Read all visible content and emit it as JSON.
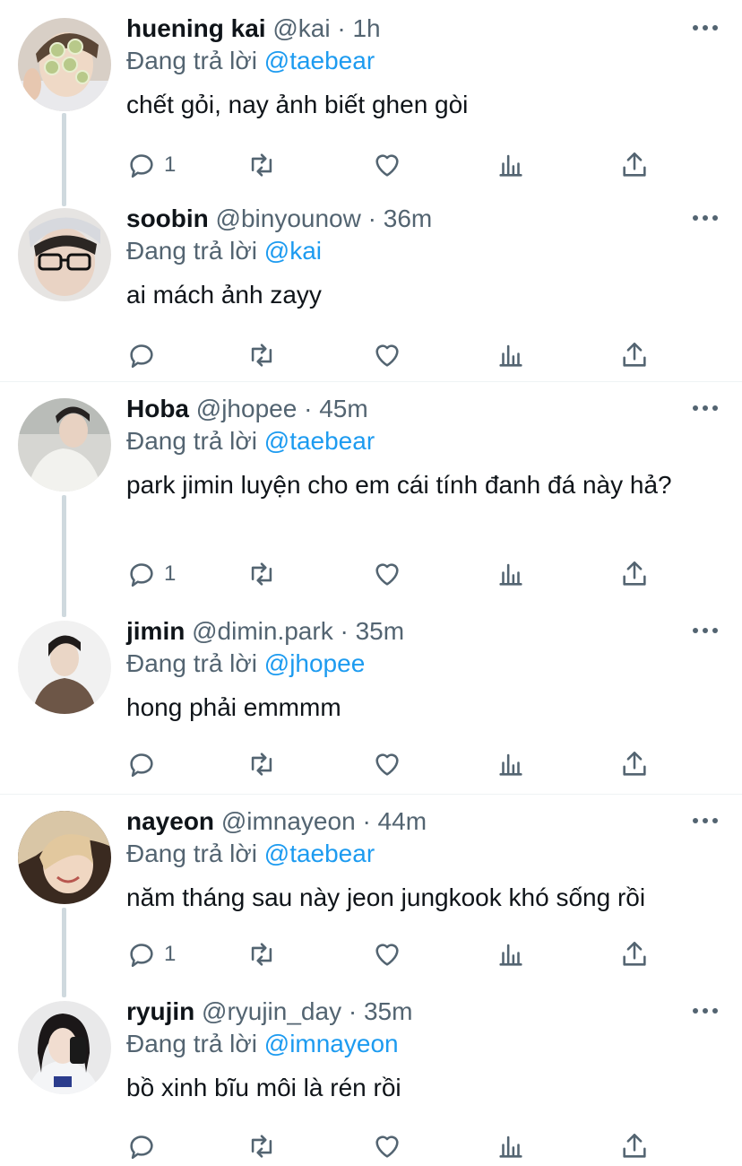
{
  "reply_prefix": "Đang trả lời",
  "colors": {
    "link": "#1d9bf0",
    "muted": "#536471",
    "text": "#0f1419",
    "thread_line": "#cfd9de"
  },
  "icons": [
    "reply-icon",
    "retweet-icon",
    "like-icon",
    "analytics-icon",
    "share-icon",
    "more-icon"
  ],
  "tweets": [
    {
      "name": "huening kai",
      "handle": "@kai",
      "sep": "·",
      "time": "1h",
      "reply_to": "@taebear",
      "text": "chết gỏi, nay ảnh biết ghen gòi",
      "reply_count": "1"
    },
    {
      "name": "soobin",
      "handle": "@binyounow",
      "sep": "·",
      "time": "36m",
      "reply_to": "@kai",
      "text": "ai mách ảnh zayy",
      "reply_count": ""
    },
    {
      "name": "Hoba",
      "handle": "@jhopee",
      "sep": "·",
      "time": "45m",
      "reply_to": "@taebear",
      "text": "park jimin luyện cho em cái tính đanh đá này hả?",
      "reply_count": "1"
    },
    {
      "name": "jimin",
      "handle": "@dimin.park",
      "sep": "·",
      "time": "35m",
      "reply_to": "@jhopee",
      "text": "hong phải emmmm",
      "reply_count": ""
    },
    {
      "name": "nayeon",
      "handle": "@imnayeon",
      "sep": "·",
      "time": "44m",
      "reply_to": "@taebear",
      "text": "năm tháng sau này jeon jungkook khó sống rồi",
      "reply_count": "1"
    },
    {
      "name": "ryujin",
      "handle": "@ryujin_day",
      "sep": "·",
      "time": "35m",
      "reply_to": "@imnayeon",
      "text": "bồ xinh bĩu môi là rén rồi",
      "reply_count": ""
    }
  ]
}
